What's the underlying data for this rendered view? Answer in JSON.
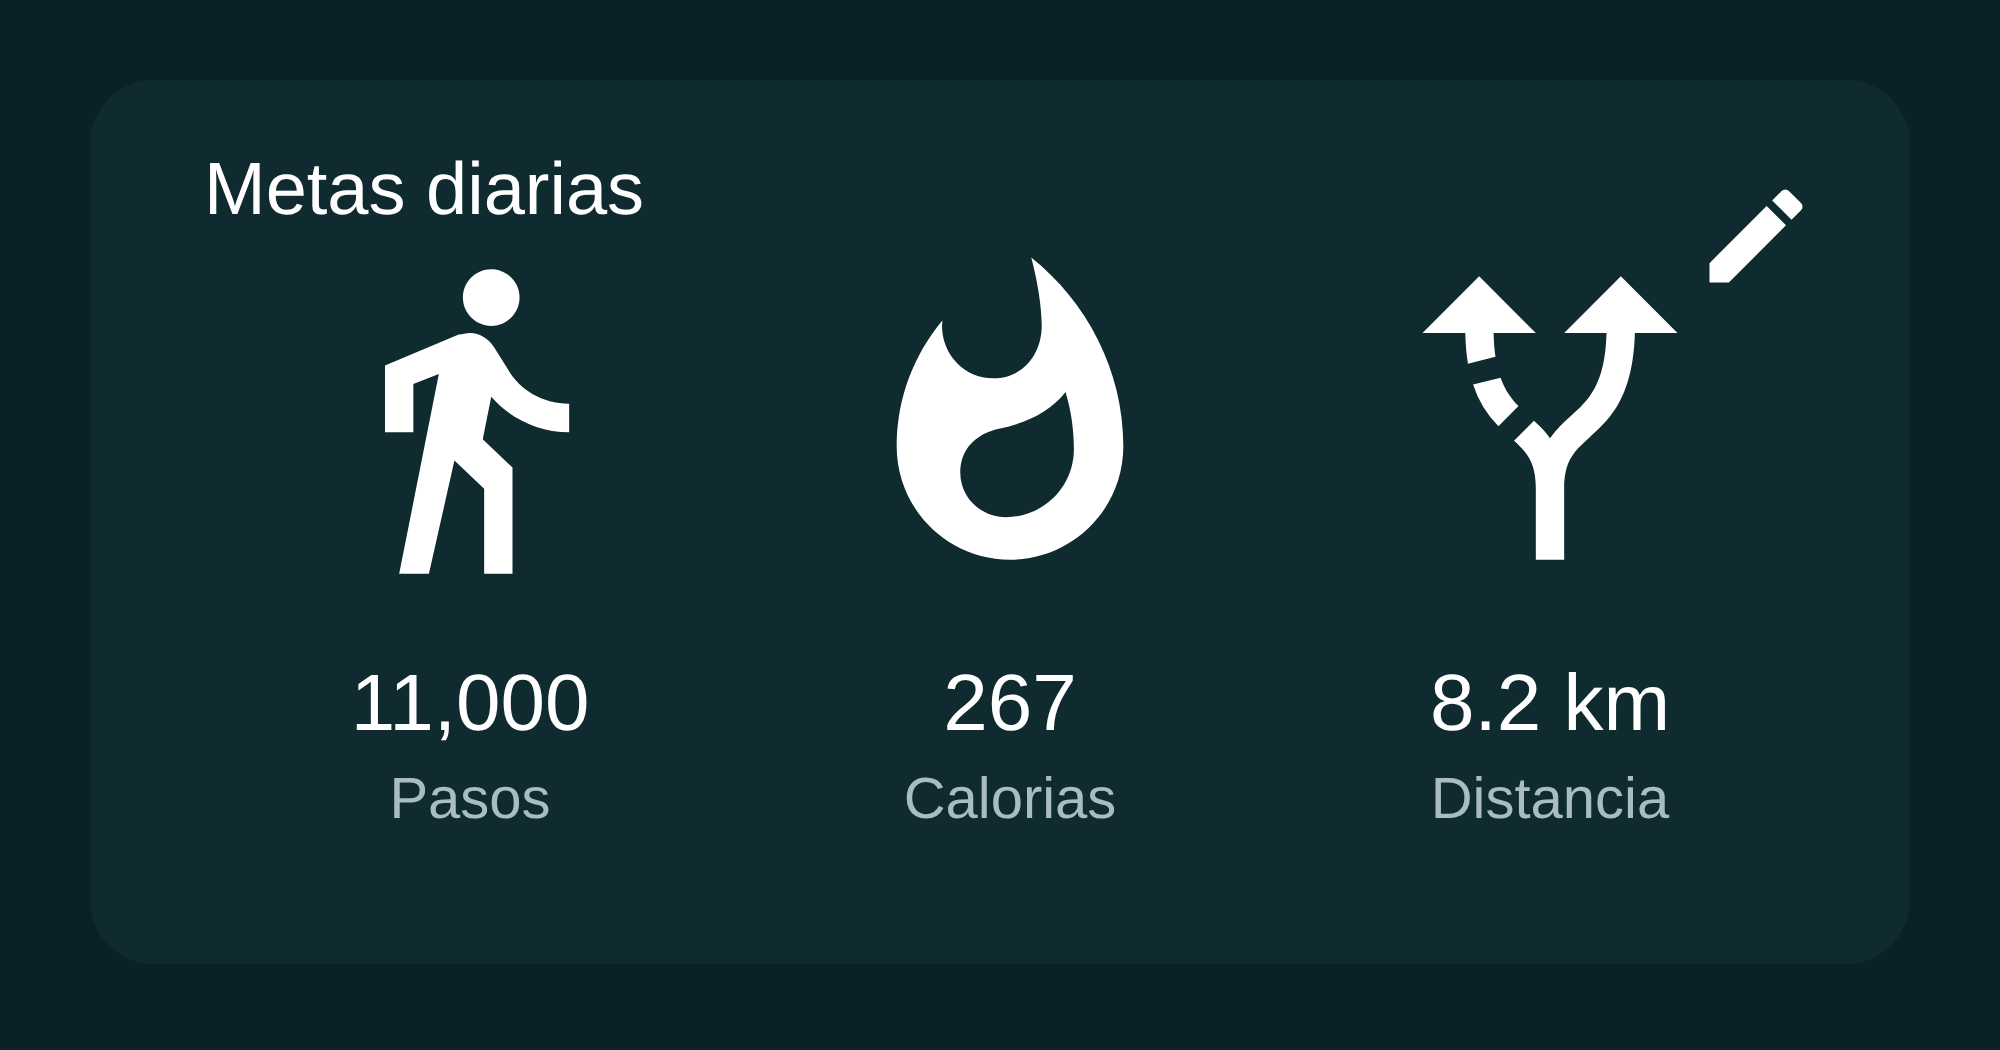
{
  "card": {
    "title": "Metas diarias",
    "stats": [
      {
        "kind": "steps",
        "value": "11,000",
        "label": "Pasos"
      },
      {
        "kind": "calories",
        "value": "267",
        "label": "Calorias"
      },
      {
        "kind": "distance",
        "value": "8.2 km",
        "label": "Distancia"
      }
    ]
  }
}
